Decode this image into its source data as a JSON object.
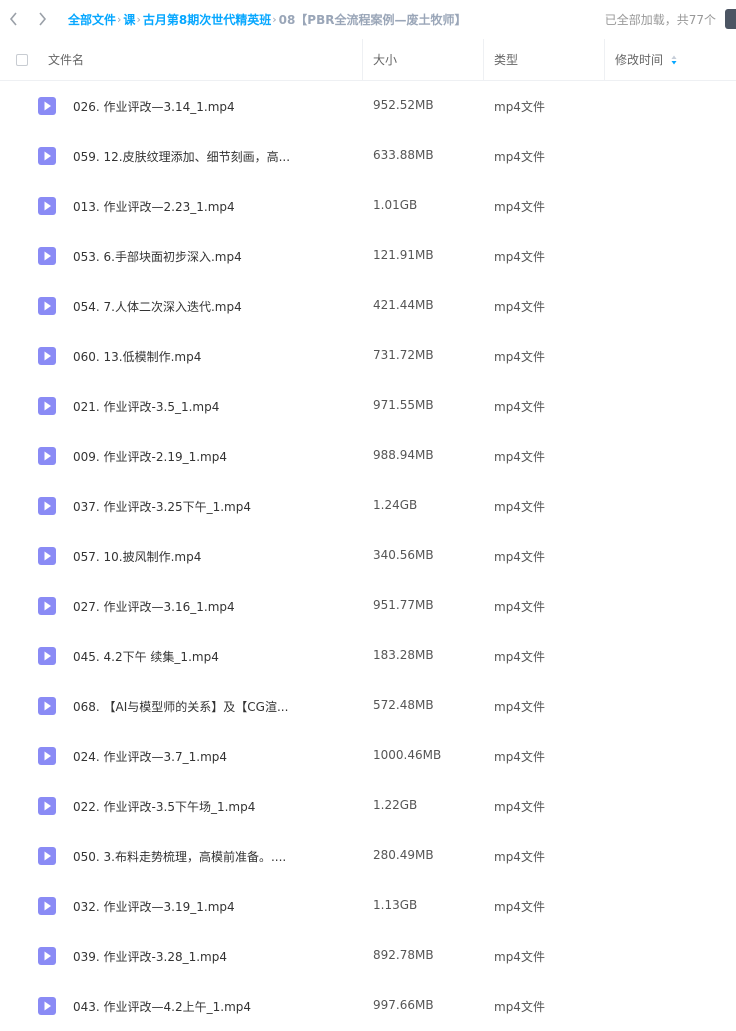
{
  "breadcrumb": {
    "items": [
      "全部文件",
      "课",
      "古月第8期次世代精英班"
    ],
    "current": "08【PBR全流程案例—废土牧师】"
  },
  "status": "已全部加载，共77个",
  "columns": {
    "name": "文件名",
    "size": "大小",
    "type": "类型",
    "modified": "修改时间"
  },
  "colors": {
    "accent": "#06a7ff",
    "video_icon": "#8a8bf5"
  },
  "files": [
    {
      "name": "026. 作业评改—3.14_1.mp4",
      "size": "952.52MB",
      "type": "mp4文件",
      "icon": "video-file-icon"
    },
    {
      "name": "059. 12.皮肤纹理添加、细节刻画，高...",
      "size": "633.88MB",
      "type": "mp4文件",
      "icon": "video-file-icon"
    },
    {
      "name": "013. 作业评改—2.23_1.mp4",
      "size": "1.01GB",
      "type": "mp4文件",
      "icon": "video-file-icon"
    },
    {
      "name": "053. 6.手部块面初步深入.mp4",
      "size": "121.91MB",
      "type": "mp4文件",
      "icon": "video-file-icon"
    },
    {
      "name": "054. 7.人体二次深入迭代.mp4",
      "size": "421.44MB",
      "type": "mp4文件",
      "icon": "video-file-icon"
    },
    {
      "name": "060. 13.低模制作.mp4",
      "size": "731.72MB",
      "type": "mp4文件",
      "icon": "video-file-icon"
    },
    {
      "name": "021. 作业评改-3.5_1.mp4",
      "size": "971.55MB",
      "type": "mp4文件",
      "icon": "video-file-icon"
    },
    {
      "name": "009. 作业评改-2.19_1.mp4",
      "size": "988.94MB",
      "type": "mp4文件",
      "icon": "video-file-icon"
    },
    {
      "name": "037. 作业评改-3.25下午_1.mp4",
      "size": "1.24GB",
      "type": "mp4文件",
      "icon": "video-file-icon"
    },
    {
      "name": "057. 10.披风制作.mp4",
      "size": "340.56MB",
      "type": "mp4文件",
      "icon": "video-file-icon"
    },
    {
      "name": "027. 作业评改—3.16_1.mp4",
      "size": "951.77MB",
      "type": "mp4文件",
      "icon": "video-file-icon"
    },
    {
      "name": "045. 4.2下午 续集_1.mp4",
      "size": "183.28MB",
      "type": "mp4文件",
      "icon": "video-file-icon"
    },
    {
      "name": "068. 【AI与模型师的关系】及【CG渲...",
      "size": "572.48MB",
      "type": "mp4文件",
      "icon": "video-file-icon"
    },
    {
      "name": "024. 作业评改—3.7_1.mp4",
      "size": "1000.46MB",
      "type": "mp4文件",
      "icon": "video-file-icon"
    },
    {
      "name": "022. 作业评改-3.5下午场_1.mp4",
      "size": "1.22GB",
      "type": "mp4文件",
      "icon": "video-file-icon"
    },
    {
      "name": "050. 3.布料走势梳理，高模前准备。....",
      "size": "280.49MB",
      "type": "mp4文件",
      "icon": "video-file-icon"
    },
    {
      "name": "032. 作业评改—3.19_1.mp4",
      "size": "1.13GB",
      "type": "mp4文件",
      "icon": "video-file-icon"
    },
    {
      "name": "039. 作业评改-3.28_1.mp4",
      "size": "892.78MB",
      "type": "mp4文件",
      "icon": "video-file-icon"
    },
    {
      "name": "043. 作业评改—4.2上午_1.mp4",
      "size": "997.66MB",
      "type": "mp4文件",
      "icon": "video-file-icon"
    }
  ]
}
